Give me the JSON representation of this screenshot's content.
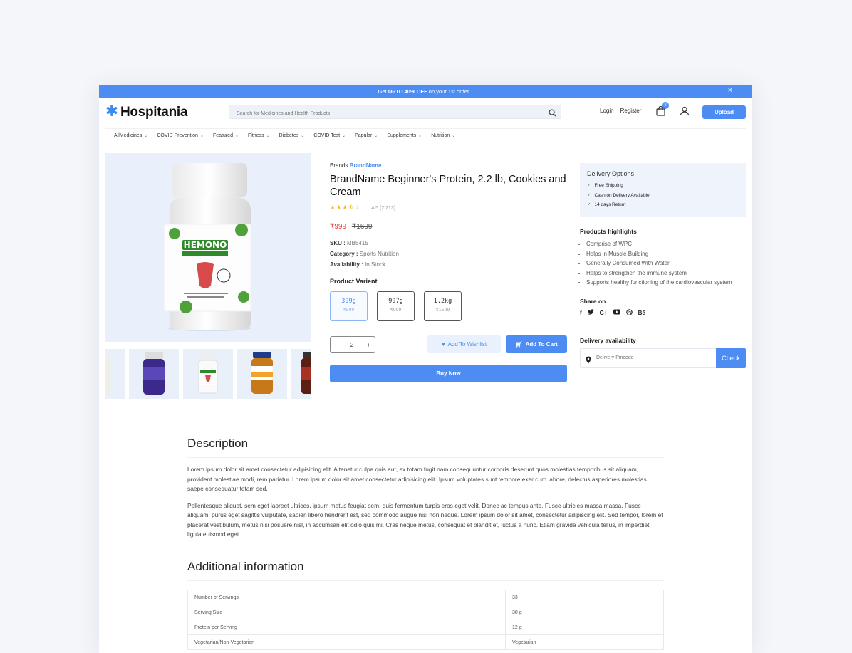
{
  "promo": {
    "prefix": "Get",
    "highlight": "UPTO 40% OFF",
    "suffix": "on your 1st order...",
    "close": "×"
  },
  "header": {
    "logo": "Hospitania",
    "search_placeholder": "Search for Medicines and Health Products",
    "login": "Login",
    "register": "Register",
    "cart_count": "2",
    "upload": "Upload"
  },
  "menu": [
    "AllMedicines",
    "COVID Prevention",
    "Featured",
    "Fitness",
    "Diabetes",
    "COVID Test",
    "Papular",
    "Supplements",
    "Nutrition"
  ],
  "product": {
    "brand_label": "Brands",
    "brand_name": "BrandName",
    "title": "BrandName Beginner's Protein, 2.2 lb, Cookies and Cream",
    "rating_text": "4.5 (2,213)",
    "rating_value": 3.5,
    "price_now": "₹999",
    "price_old": "₹1699",
    "sku_label": "SKU :",
    "sku": "MB5415",
    "category_label": "Category :",
    "category": "Sports Nutrition",
    "availability_label": "Availability :",
    "availability": "In Stock",
    "variant_title": "Product Varient",
    "variants": [
      {
        "size": "399g",
        "price": "₹599"
      },
      {
        "size": "997g",
        "price": "₹999"
      },
      {
        "size": "1.2kg",
        "price": "₹1599"
      }
    ],
    "qty_minus": "-",
    "quantity": "2",
    "qty_plus": "+",
    "wishlist": "Add To Wishlist",
    "add_cart": "Add To Cart",
    "buy_now": "Buy Now",
    "image_label": "HEMONO"
  },
  "side": {
    "delivery_title": "Delivery Options",
    "delivery_options": [
      "Free Shipping",
      "Cash on Delivery Available",
      "14 days Return"
    ],
    "highlights_title": "Products highlights",
    "highlights": [
      "Comprise of WPC",
      "Helps in Muscle Building",
      "Generally Consumed With Water",
      "Helps to strengthen the immune system",
      "Supports healthy functioning of the cardiovascular system"
    ],
    "share_title": "Share on",
    "share_icons": [
      "f",
      "G+",
      "Bē"
    ],
    "availability_title": "Delivery availability",
    "pincode_placeholder": "Delivery Pincode",
    "check": "Check"
  },
  "description": {
    "title": "Description",
    "p1": "Lorem ipsum dolor sit amet consectetur adipisicing elit. A tenetur culpa quis aut, ex totam fugit nam consequuntur corporis deserunt quos molestias temporibus sit aliquam, provident molestiae modi, rem pariatur. Lorem ipsum dolor sit amet consectetur adipisicing elit. Ipsum voluptates sunt tempore exer cum labore, delectus asperiores molestias saepe consequatur totam sed.",
    "p2": "Pellentesque aliquet, sem eget laoreet ultrices, ipsum metus feugiat sem, quis fermentum turpis eros eget velit. Donec ac tempus ante. Fusce ultricies massa massa. Fusce aliquam, purus eget sagittis vulputate, sapien libero hendrerit est, sed commodo augue nisi non neque. Lorem ipsum dolor sit amet, consectetur adipiscing elit. Sed tempor, lorem et placerat vestibulum, metus nisi posuere nisl, in accumsan elit odio quis mi. Cras neque metus, consequat et blandit et, luctus a nunc. Etiam gravida vehicula tellus, in imperdiet ligula euismod eget."
  },
  "additional": {
    "title": "Additional information",
    "rows": [
      {
        "label": "Number of Servings",
        "value": "33"
      },
      {
        "label": "Serving Size",
        "value": "30 g"
      },
      {
        "label": "Protein per Serving",
        "value": "12 g"
      },
      {
        "label": "Vegetarian/Non-Vegetarian",
        "value": "Vegetarian"
      }
    ]
  },
  "colors": {
    "accent": "#4d8df3",
    "price": "#e53935",
    "star": "#f3b824"
  }
}
